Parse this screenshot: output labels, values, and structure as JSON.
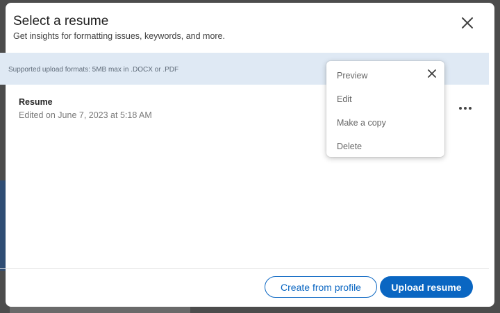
{
  "modal": {
    "title": "Select a resume",
    "subtitle": "Get insights for formatting issues, keywords, and more."
  },
  "format_notice": "Supported upload formats: 5MB max in .DOCX or .PDF",
  "resume": {
    "name": "Resume",
    "edited": "Edited on June 7, 2023 at 5:18 AM"
  },
  "menu": {
    "items": [
      {
        "label": "Preview"
      },
      {
        "label": "Edit"
      },
      {
        "label": "Make a copy"
      },
      {
        "label": "Delete"
      }
    ]
  },
  "footer": {
    "create_label": "Create from profile",
    "upload_label": "Upload resume"
  },
  "colors": {
    "accent": "#0a66c2",
    "notice_bg": "#dfe9f4"
  },
  "icons": {
    "close": "close-icon",
    "more": "more-options-icon"
  }
}
